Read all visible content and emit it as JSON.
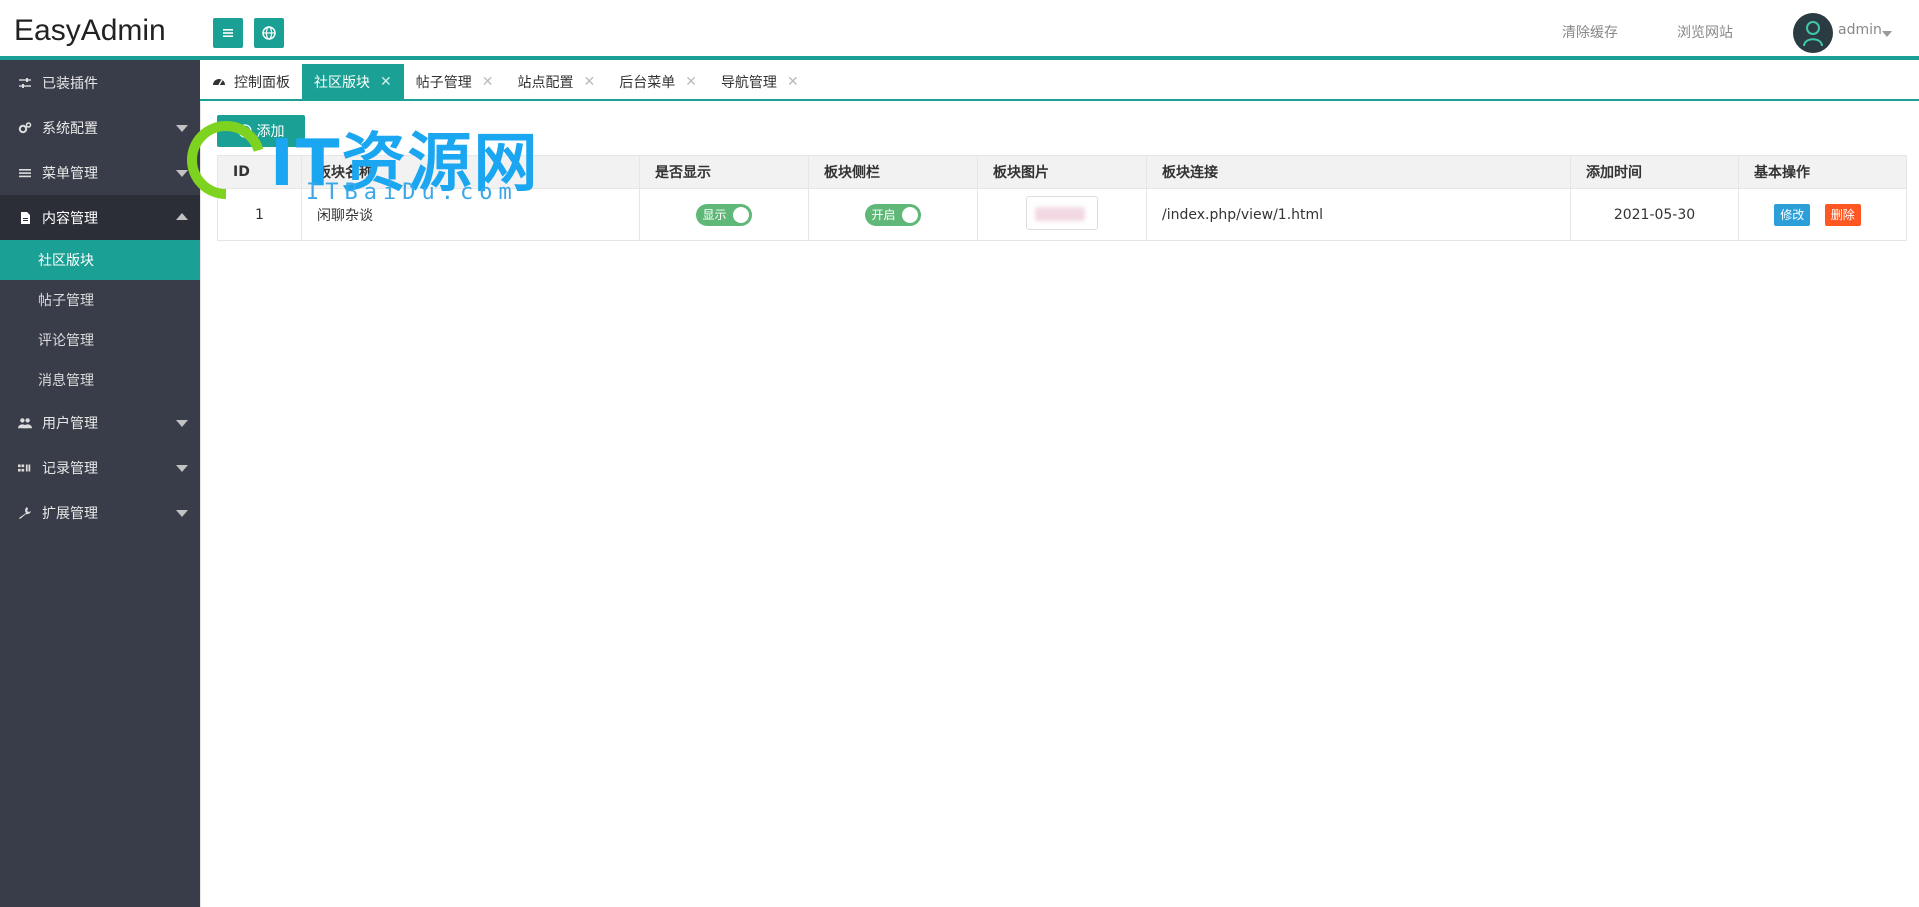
{
  "header": {
    "logo": "EasyAdmin",
    "clear_cache": "清除缓存",
    "browse_site": "浏览网站",
    "username": "admin"
  },
  "sidebar": {
    "items": [
      {
        "label": "已装插件",
        "icon": "sliders-icon"
      },
      {
        "label": "系统配置",
        "icon": "cogs-icon",
        "has_arrow": true
      },
      {
        "label": "菜单管理",
        "icon": "bars-icon",
        "has_arrow": true
      },
      {
        "label": "内容管理",
        "icon": "file-icon",
        "open": true
      },
      {
        "label": "用户管理",
        "icon": "users-icon",
        "has_arrow": true
      },
      {
        "label": "记录管理",
        "icon": "grid-icon",
        "has_arrow": true
      },
      {
        "label": "扩展管理",
        "icon": "wrench-icon",
        "has_arrow": true
      }
    ],
    "sub_items": [
      "社区版块",
      "帖子管理",
      "评论管理",
      "消息管理"
    ],
    "active_sub": "社区版块"
  },
  "tabs": [
    {
      "label": "控制面板",
      "icon": "dashboard-icon"
    },
    {
      "label": "社区版块",
      "active": true
    },
    {
      "label": "帖子管理"
    },
    {
      "label": "站点配置"
    },
    {
      "label": "后台菜单"
    },
    {
      "label": "导航管理"
    }
  ],
  "toolbar": {
    "add_label": "添加"
  },
  "table": {
    "headers": [
      "ID",
      "板块名称",
      "是否显示",
      "板块侧栏",
      "板块图片",
      "板块连接",
      "添加时间",
      "基本操作"
    ],
    "rows": [
      {
        "id": "1",
        "name": "闲聊杂谈",
        "show": "显示",
        "sidebar": "开启",
        "link": "/index.php/view/1.html",
        "date": "2021-05-30",
        "edit": "修改",
        "delete": "删除"
      }
    ]
  },
  "watermark": {
    "title": "IT资源网",
    "subtitle": "ITBaiDu.com"
  },
  "colors": {
    "accent": "#1aa094",
    "sidebar_bg": "#393d49",
    "switch_on": "#5fb878",
    "edit": "#2d9fd8",
    "delete": "#ff5722"
  }
}
